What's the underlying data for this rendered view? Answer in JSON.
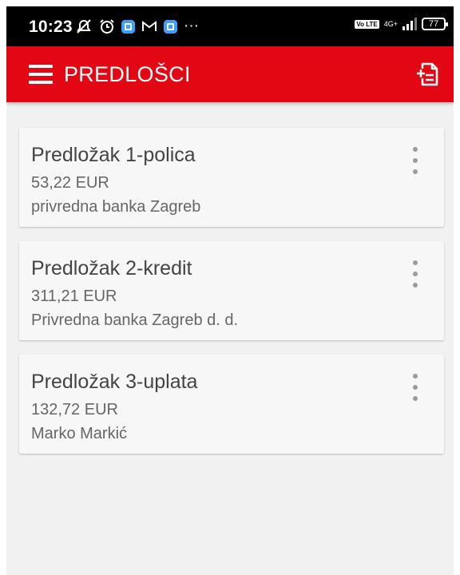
{
  "status_bar": {
    "time": "10:23",
    "more_glyph": "···",
    "volte": "Vo LTE",
    "network": "4G+",
    "battery": "77"
  },
  "app_bar": {
    "title": "PREDLOŠCI",
    "menu_icon": "hamburger-menu-icon",
    "action_icon": "add-document-icon",
    "background": "#e30613"
  },
  "templates": [
    {
      "title": "Predložak 1-polica",
      "amount": "53,22 EUR",
      "payee": "privredna banka Zagreb"
    },
    {
      "title": "Predložak 2-kredit",
      "amount": "311,21 EUR",
      "payee": "Privredna banka Zagreb d. d."
    },
    {
      "title": "Predložak 3-uplata",
      "amount": "132,72 EUR",
      "payee": "Marko Markić"
    }
  ]
}
